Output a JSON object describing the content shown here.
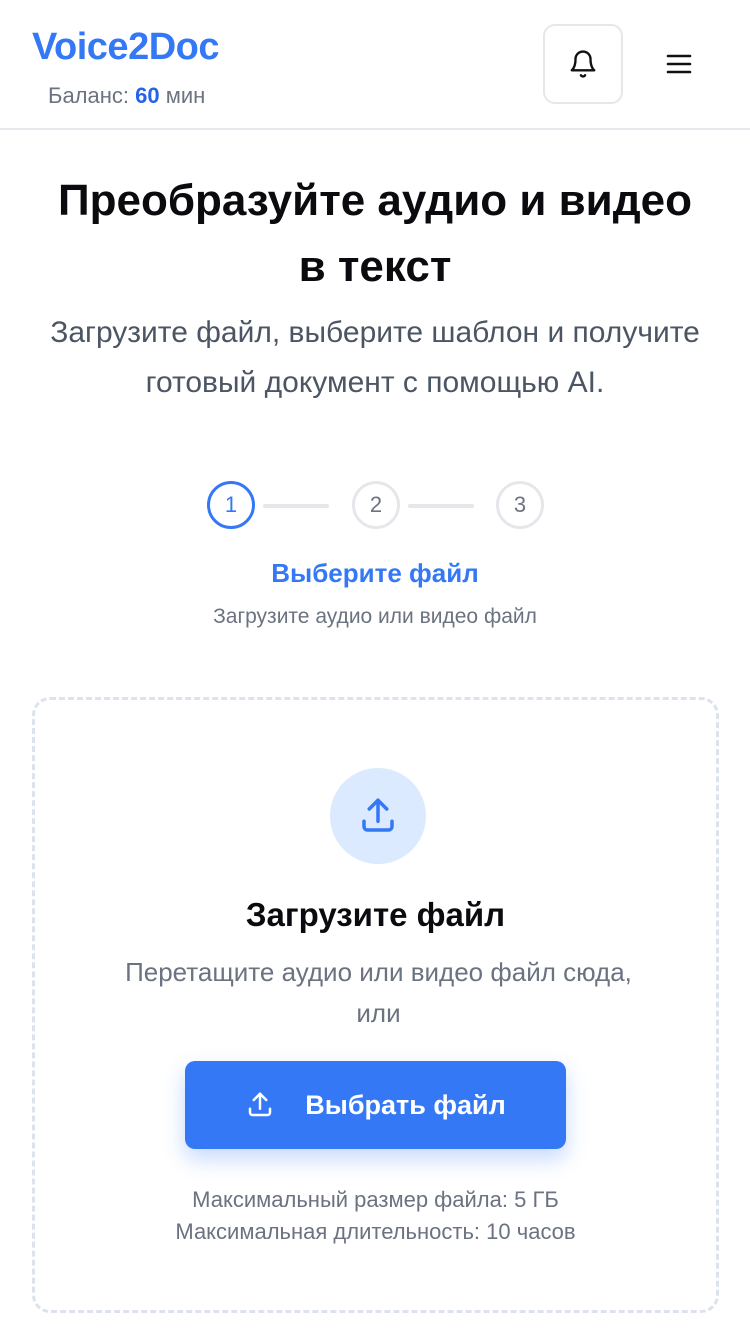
{
  "header": {
    "logo": "Voice2Doc",
    "balance_label": "Баланс:",
    "balance_value": "60",
    "balance_unit": "мин",
    "notification_icon": "bell-icon",
    "menu_icon": "hamburger-menu-icon"
  },
  "hero": {
    "title_line1": "Преобразуйте аудио и видео",
    "title_line2": "в текст",
    "subtitle_line1": "Загрузите файл, выберите шаблон и получите",
    "subtitle_line2": "готовый документ с помощью AI."
  },
  "stepper": {
    "steps": [
      "1",
      "2",
      "3"
    ],
    "active_step": 1,
    "current_title": "Выберите файл",
    "current_desc": "Загрузите аудио или видео файл"
  },
  "dropzone": {
    "icon": "upload-icon",
    "title": "Загрузите файл",
    "desc_line1": "Перетащите аудио или видео файл сюда,",
    "desc_line2": "или",
    "button_label": "Выбрать файл",
    "max_size": "Максимальный размер файла: 5 ГБ",
    "max_duration": "Максимальная длительность: 10 часов"
  },
  "colors": {
    "accent": "#3478f6",
    "accent_light": "#dbeafe",
    "muted_text": "#6b7280",
    "border": "#e5e7eb"
  }
}
